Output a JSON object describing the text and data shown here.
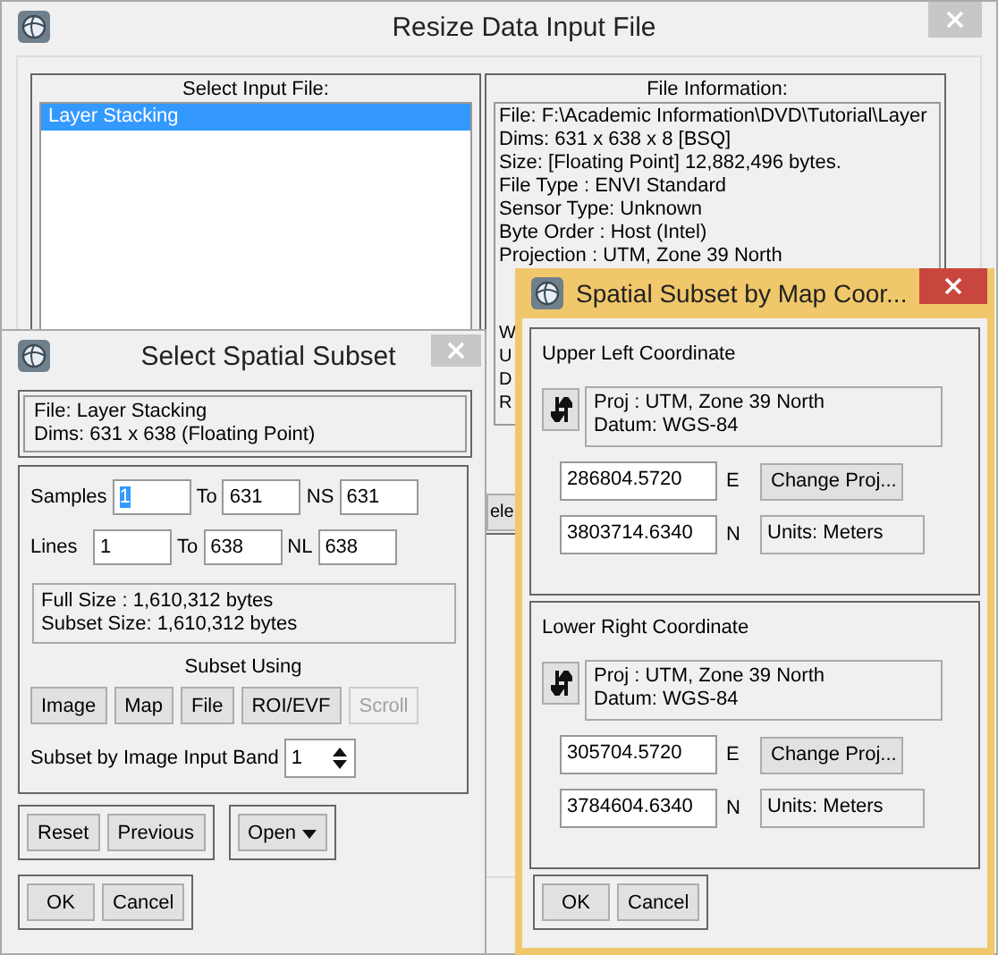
{
  "main_window": {
    "title": "Resize Data Input File",
    "active": false,
    "input_file": {
      "heading": "Select Input File:",
      "items": [
        {
          "label": "Layer Stacking",
          "selected": true
        }
      ]
    },
    "file_info": {
      "heading": "File Information:",
      "lines": [
        "File: F:\\Academic Information\\DVD\\Tutorial\\Layer",
        "Dims: 631 x 638 x 8 [BSQ]",
        "Size: [Floating Point] 12,882,496 bytes.",
        "File Type  : ENVI Standard",
        "Sensor Type: Unknown",
        "Byte Order : Host (Intel)",
        "Projection : UTM, Zone 39 North"
      ],
      "fragment_lines": [
        "W",
        "U",
        "D",
        "R"
      ]
    },
    "button_fragment": "ele"
  },
  "subset_window": {
    "title": "Select Spatial Subset",
    "active": false,
    "file_lines": [
      "File: Layer Stacking",
      "Dims: 631 x 638 (Floating Point)"
    ],
    "rows": [
      {
        "label": "Samples",
        "from": "1",
        "from_selected": true,
        "to_label": "To",
        "to": "631",
        "count_label": "NS",
        "count": "631"
      },
      {
        "label": "Lines",
        "from": "1",
        "from_selected": false,
        "to_label": "To",
        "to": "638",
        "count_label": "NL",
        "count": "638"
      }
    ],
    "size_lines": [
      "Full Size  : 1,610,312 bytes",
      "Subset Size: 1,610,312 bytes"
    ],
    "subset_using": {
      "label": "Subset Using",
      "buttons": [
        {
          "label": "Image",
          "disabled": false
        },
        {
          "label": "Map",
          "disabled": false
        },
        {
          "label": "File",
          "disabled": false
        },
        {
          "label": "ROI/EVF",
          "disabled": false
        },
        {
          "label": "Scroll",
          "disabled": true
        }
      ]
    },
    "band": {
      "label": "Subset by Image Input Band",
      "value": "1"
    },
    "buttons": [
      "Reset",
      "Previous"
    ],
    "open_button": "Open",
    "footer_buttons": [
      "OK",
      "Cancel"
    ]
  },
  "map_window": {
    "title": "Spatial Subset by Map Coor...",
    "active": true,
    "groups": [
      {
        "heading": "Upper Left Coordinate",
        "proj_lines": [
          "Proj : UTM, Zone 39 North",
          "Datum: WGS-84"
        ],
        "easting": "286804.5720",
        "east_label": "E",
        "change_button": "Change Proj...",
        "northing": "3803714.6340",
        "north_label": "N",
        "units": "Units: Meters"
      },
      {
        "heading": "Lower Right Coordinate",
        "proj_lines": [
          "Proj : UTM, Zone 39 North",
          "Datum: WGS-84"
        ],
        "easting": "305704.5720",
        "east_label": "E",
        "change_button": "Change Proj...",
        "northing": "3784604.6340",
        "north_label": "N",
        "units": "Units: Meters"
      }
    ],
    "footer_buttons": [
      "OK",
      "Cancel"
    ]
  }
}
